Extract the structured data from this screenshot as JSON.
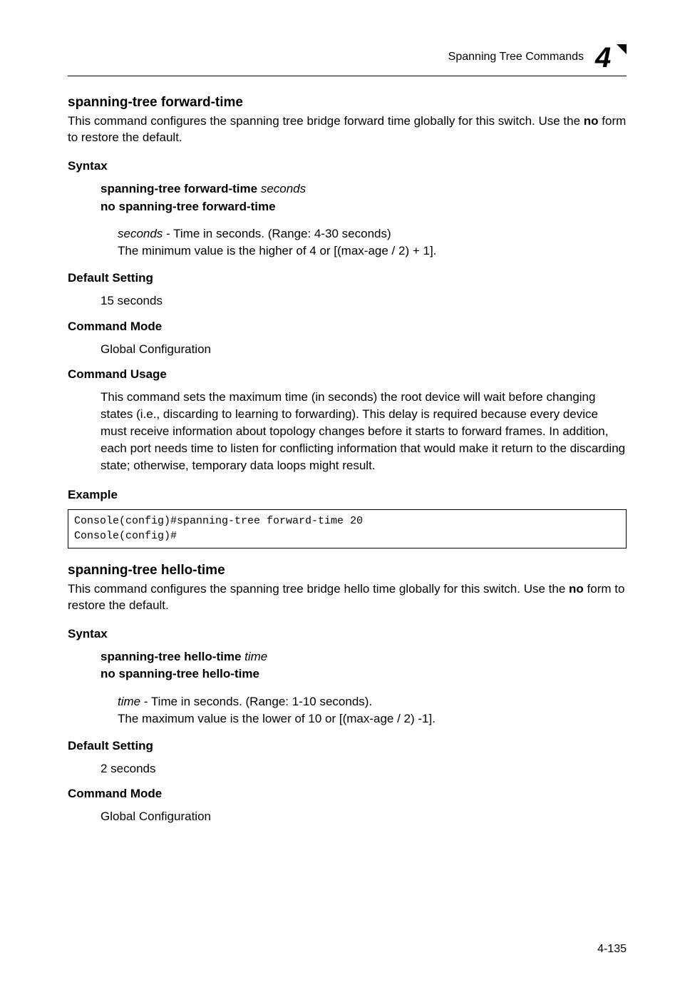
{
  "header": {
    "section_title": "Spanning Tree Commands",
    "chapter_number": "4"
  },
  "cmd1": {
    "title": "spanning-tree forward-time",
    "lead_pre_bold": "This command configures the spanning tree bridge forward time globally for this switch. Use the ",
    "lead_bold": "no",
    "lead_post_bold": " form to restore the default.",
    "syntax_heading": "Syntax",
    "syntax_cmd_bold1": "spanning-tree forward-time",
    "syntax_cmd_ital": " seconds",
    "syntax_no_line": "no spanning-tree forward-time",
    "param_ital": "seconds",
    "param_desc1": " - Time in seconds. (Range: 4-30 seconds)",
    "param_desc2": "The minimum value is the higher of 4 or [(max-age / 2) + 1].",
    "default_heading": "Default Setting",
    "default_value": "15 seconds",
    "mode_heading": "Command Mode",
    "mode_value": "Global Configuration",
    "usage_heading": "Command Usage",
    "usage_text": "This command sets the maximum time (in seconds) the root device will wait before changing states (i.e., discarding to learning to forwarding). This delay is required because every device must receive information about topology changes before it starts to forward frames. In addition, each port needs time to listen for conflicting information that would make it return to the discarding state; otherwise, temporary data loops might result.",
    "example_heading": "Example",
    "example_code": "Console(config)#spanning-tree forward-time 20\nConsole(config)#"
  },
  "cmd2": {
    "title": "spanning-tree hello-time",
    "lead_pre_bold": "This command configures the spanning tree bridge hello time globally for this switch. Use the ",
    "lead_bold": "no",
    "lead_post_bold": " form to restore the default.",
    "syntax_heading": "Syntax",
    "syntax_cmd_bold1": "spanning-tree hello-time",
    "syntax_cmd_ital": " time",
    "syntax_no_line": "no spanning-tree hello-time",
    "param_ital": "time",
    "param_desc1": " - Time in seconds. (Range: 1-10 seconds).",
    "param_desc2": "The maximum value is the lower of 10 or [(max-age / 2) -1].",
    "default_heading": "Default Setting",
    "default_value": "2 seconds",
    "mode_heading": "Command Mode",
    "mode_value": "Global Configuration"
  },
  "footer": {
    "page_number": "4-135"
  }
}
